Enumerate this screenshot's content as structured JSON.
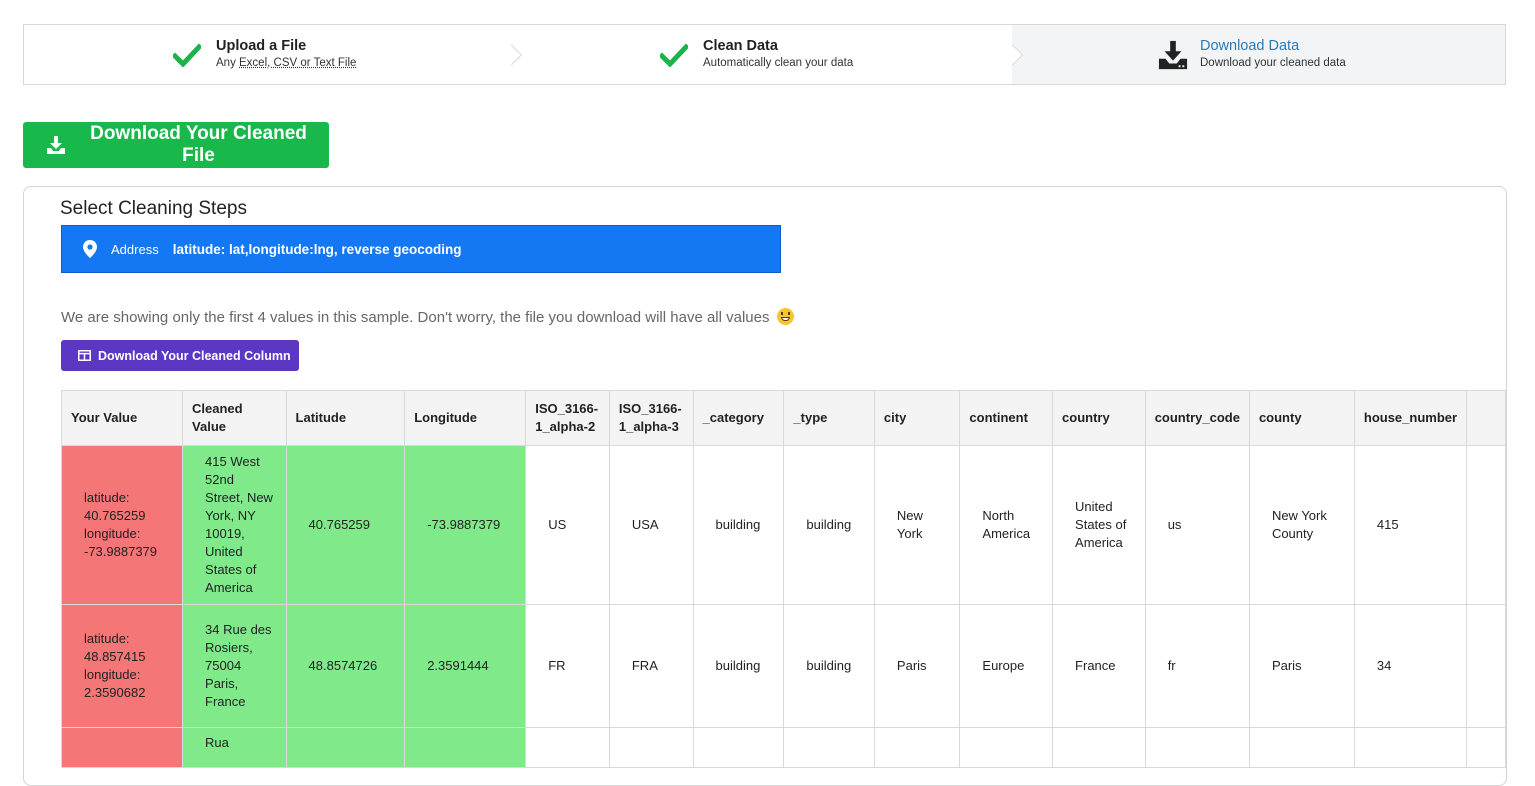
{
  "steps": [
    {
      "title": "Upload a File",
      "sub_prefix": "Any ",
      "sub_link": "Excel, CSV or Text File",
      "status": "done"
    },
    {
      "title": "Clean Data",
      "subtitle": "Automatically clean your data",
      "status": "done"
    },
    {
      "title": "Download Data",
      "subtitle": "Download your cleaned data",
      "status": "active"
    }
  ],
  "download_file_button": "Download Your Cleaned File",
  "panel": {
    "title": "Select Cleaning Steps",
    "address": {
      "label": "Address",
      "value": "latitude: lat,longitude:lng, reverse geocoding"
    },
    "note": "We are showing only the first 4 values in this sample. Don't worry, the file you download will have all values",
    "download_column_button": "Download Your Cleaned Column"
  },
  "table": {
    "headers": [
      "Your Value",
      "Cleaned Value",
      "Latitude",
      "Longitude",
      "ISO_3166-1_alpha-2",
      "ISO_3166-1_alpha-3",
      "_category",
      "_type",
      "city",
      "continent",
      "country",
      "country_code",
      "county",
      "house_number",
      ""
    ],
    "rows": [
      [
        "latitude: 40.765259 longitude: -73.9887379",
        "415 West 52nd Street, New York, NY 10019, United States of America",
        "40.765259",
        "-73.9887379",
        "US",
        "USA",
        "building",
        "building",
        "New York",
        "North America",
        "United States of America",
        "us",
        "New York County",
        "415",
        ""
      ],
      [
        "latitude: 48.857415 longitude: 2.3590682",
        "34 Rue des Rosiers, 75004 Paris, France",
        "48.8574726",
        "2.3591444",
        "FR",
        "FRA",
        "building",
        "building",
        "Paris",
        "Europe",
        "France",
        "fr",
        "Paris",
        "34",
        ""
      ],
      [
        "",
        "Rua",
        "",
        "",
        "",
        "",
        "",
        "",
        "",
        "",
        "",
        "",
        "",
        "",
        ""
      ]
    ]
  },
  "colors": {
    "success_green": "#18b84a",
    "address_blue": "#1478f5",
    "purple_button": "#5b37c4",
    "original_value_red": "#f47676",
    "cleaned_value_green": "#80e98a",
    "active_step_link": "#2a7ab8"
  },
  "icons": {
    "step_done": "checkmark-icon",
    "step_active": "download-tray-icon",
    "address": "map-pin-icon",
    "column_button": "table-icon"
  }
}
